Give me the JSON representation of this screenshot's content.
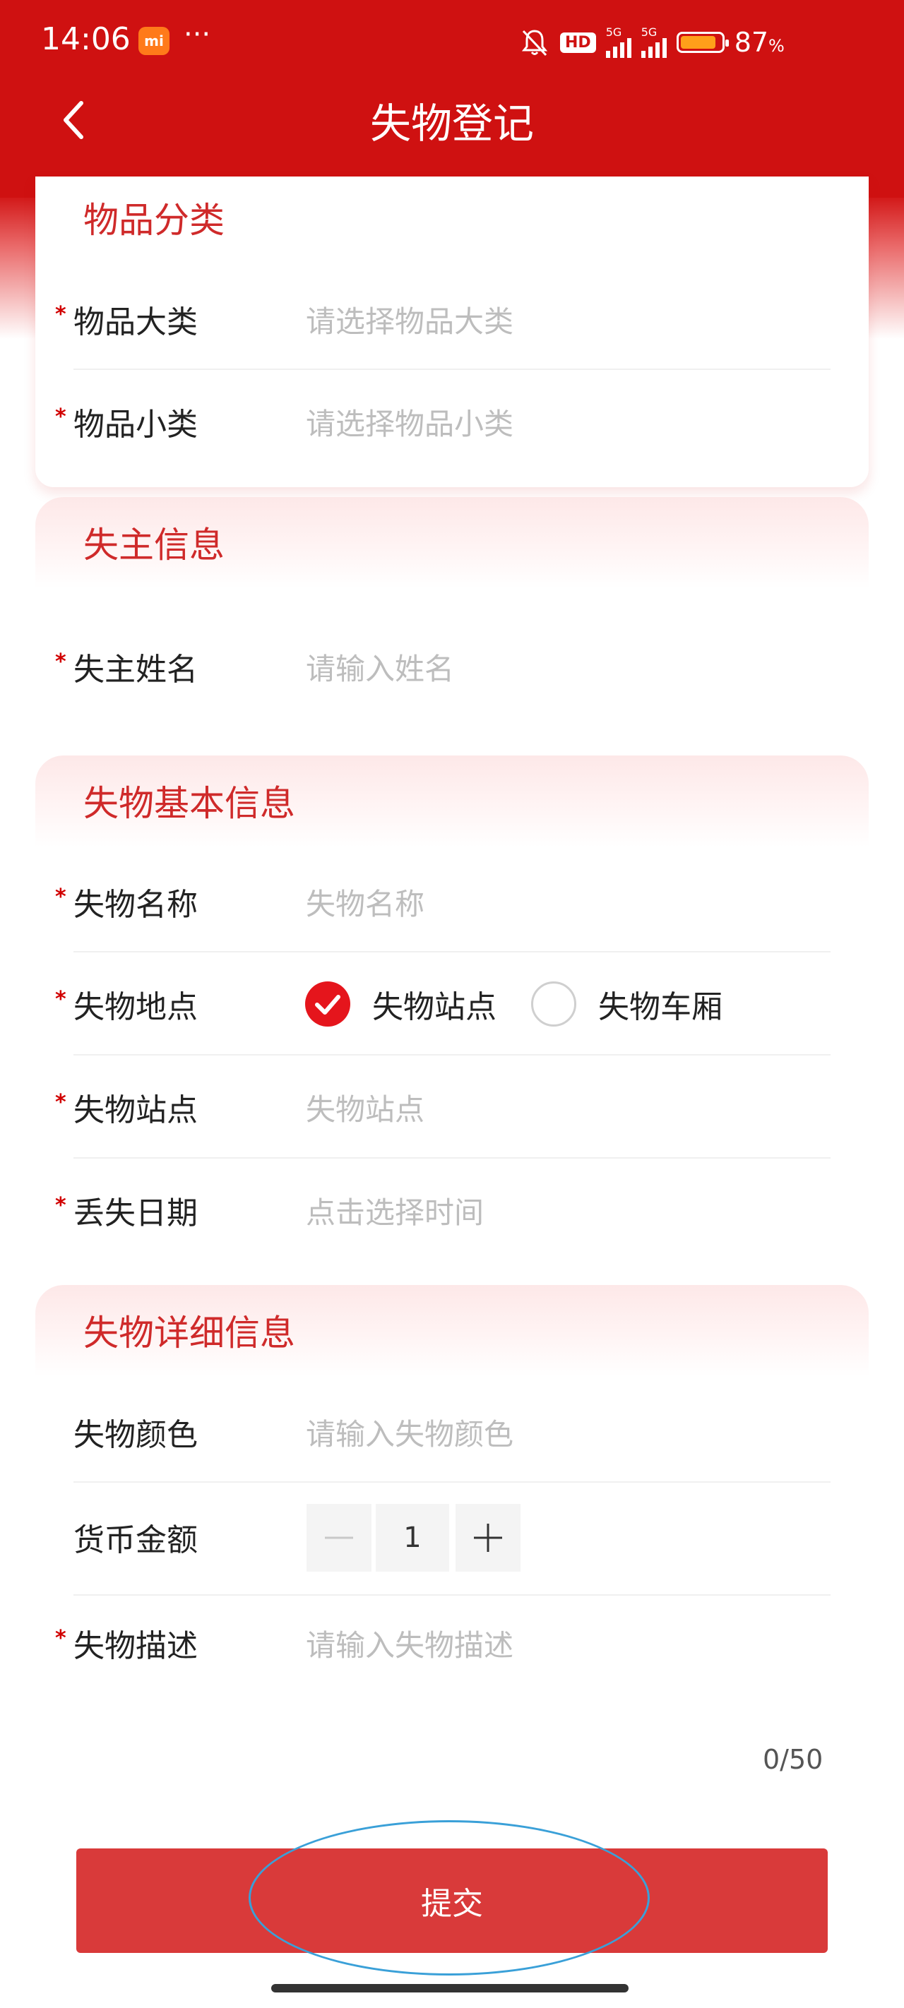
{
  "status_bar": {
    "time": "14:06",
    "mi_badge": "mi",
    "more": "···",
    "hd": "HD",
    "net1": "5G",
    "net2": "5G",
    "battery_pct": "87",
    "battery_unit": "%",
    "battery_level": 0.87
  },
  "header": {
    "title": "失物登记"
  },
  "required_mark": "*",
  "sections": {
    "category": {
      "title": "物品分类",
      "fields": [
        {
          "label": "物品大类",
          "placeholder": "请选择物品大类"
        },
        {
          "label": "物品小类",
          "placeholder": "请选择物品小类"
        }
      ]
    },
    "owner": {
      "title": "失主信息",
      "fields": [
        {
          "label": "失主姓名",
          "placeholder": "请输入姓名"
        }
      ]
    },
    "basic": {
      "title": "失物基本信息",
      "fields": [
        {
          "label": "失物名称",
          "placeholder": "失物名称"
        },
        {
          "label": "失物地点"
        },
        {
          "label": "失物站点",
          "placeholder": "失物站点"
        },
        {
          "label": "丢失日期",
          "placeholder": "点击选择时间"
        }
      ],
      "location_options": [
        {
          "label": "失物站点",
          "selected": true
        },
        {
          "label": "失物车厢",
          "selected": false
        }
      ]
    },
    "detail": {
      "title": "失物详细信息",
      "fields": [
        {
          "label": "失物颜色",
          "placeholder": "请输入失物颜色"
        },
        {
          "label": "货币金额",
          "value": "1"
        },
        {
          "label": "失物描述",
          "placeholder": "请输入失物描述"
        }
      ],
      "counter": "0/50"
    }
  },
  "submit_label": "提交",
  "colors": {
    "brand": "#cf1111",
    "submit": "#d93a3a",
    "section_title": "#cf2a2a",
    "highlight": "#3aa0d8"
  }
}
